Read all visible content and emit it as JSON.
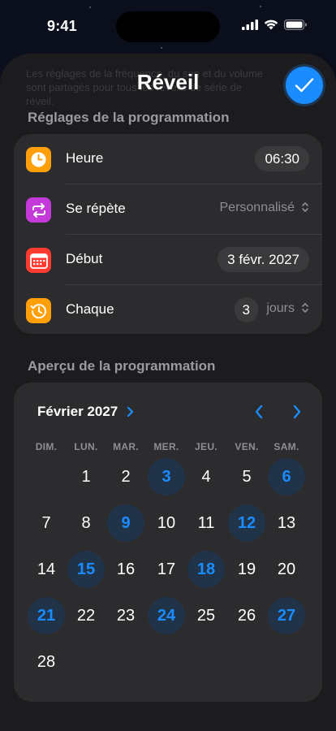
{
  "status_bar": {
    "time": "9:41"
  },
  "sheet": {
    "faded_text": "Les réglages de la fréquence, du son et du volume sont partagés pour tous les réveils de série de réveil.",
    "title": "Réveil"
  },
  "schedule_settings": {
    "section_title": "Réglages de la programmation",
    "rows": [
      {
        "label": "Heure",
        "value": "06:30",
        "icon": "clock-icon",
        "color": "#ff9f0a"
      },
      {
        "label": "Se répète",
        "value": "Personnalisé",
        "icon": "repeat-icon",
        "color": "#c33ad9"
      },
      {
        "label": "Début",
        "value": "3 févr. 2027",
        "icon": "calendar-icon",
        "color": "#ff3b30"
      },
      {
        "label": "Chaque",
        "value": "3",
        "unit": "jours",
        "icon": "history-icon",
        "color": "#ff9f0a"
      }
    ]
  },
  "preview": {
    "section_title": "Aperçu de la programmation",
    "month_label": "Février 2027",
    "weekdays": [
      "DIM.",
      "LUN.",
      "MAR.",
      "MER.",
      "JEU.",
      "VEN.",
      "SAM."
    ],
    "first_weekday_index": 1,
    "days_in_month": 28,
    "selected_days": [
      3,
      6,
      9,
      12,
      15,
      18,
      21,
      24,
      27
    ],
    "accent_color": "#1a8cff"
  }
}
